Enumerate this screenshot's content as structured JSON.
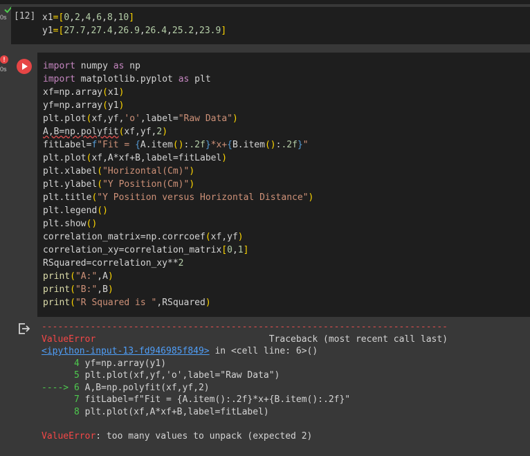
{
  "cell1": {
    "status": "0s",
    "exec_count": "[12]",
    "code": [
      "x1=[0,2,4,6,8,10]",
      "y1=[27.7,27.4,26.9,26.4,25.2,23.9]"
    ]
  },
  "cell2": {
    "status": "0s",
    "error_badge": "!",
    "code": [
      "import numpy as np",
      "import matplotlib.pyplot as plt",
      "xf=np.array(x1)",
      "yf=np.array(y1)",
      "plt.plot(xf,yf,'o',label=\"Raw Data\")",
      "A,B=np.polyfit(xf,yf,2)",
      "fitLabel=f\"Fit = {A.item():.2f}*x+{B.item():.2f}\"",
      "plt.plot(xf,A*xf+B,label=fitLabel)",
      "plt.xlabel(\"Horizontal(Cm)\")",
      "plt.ylabel(\"Y Position(Cm)\")",
      "plt.title(\"Y Position versus Horizontal Distance\")",
      "plt.legend()",
      "plt.show()",
      "correlation_matrix=np.corrcoef(xf,yf)",
      "correlation_xy=correlation_matrix[0,1]",
      "RSquared=correlation_xy**2",
      "print(\"A:\",A)",
      "print(\"B:\",B)",
      "print(\"R Squared is \",RSquared)"
    ]
  },
  "output": {
    "dashes": "---------------------------------------------------------------------------",
    "error_name": "ValueError",
    "traceback_label": "Traceback (most recent call last)",
    "input_link": "<ipython-input-13-fd946985f849>",
    "in_text": " in <cell line: 6>()",
    "lines": [
      {
        "prefix": "      4 ",
        "text": "yf=np.array(y1)"
      },
      {
        "prefix": "      5 ",
        "text": "plt.plot(xf,yf,'o',label=\"Raw Data\")"
      },
      {
        "prefix": "----> 6 ",
        "text": "A,B=np.polyfit(xf,yf,2)"
      },
      {
        "prefix": "      7 ",
        "text": "fitLabel=f\"Fit = {A.item():.2f}*x+{B.item():.2f}\""
      },
      {
        "prefix": "      8 ",
        "text": "plt.plot(xf,A*xf+B,label=fitLabel)"
      }
    ],
    "final_error_name": "ValueError",
    "final_message": ": too many values to unpack (expected 2)"
  },
  "colors": {
    "keyword": "#c586c0",
    "string": "#ce9178",
    "number": "#b5cea8",
    "function": "#dcdcaa",
    "error": "#f44747",
    "link": "#4f9ef8"
  }
}
